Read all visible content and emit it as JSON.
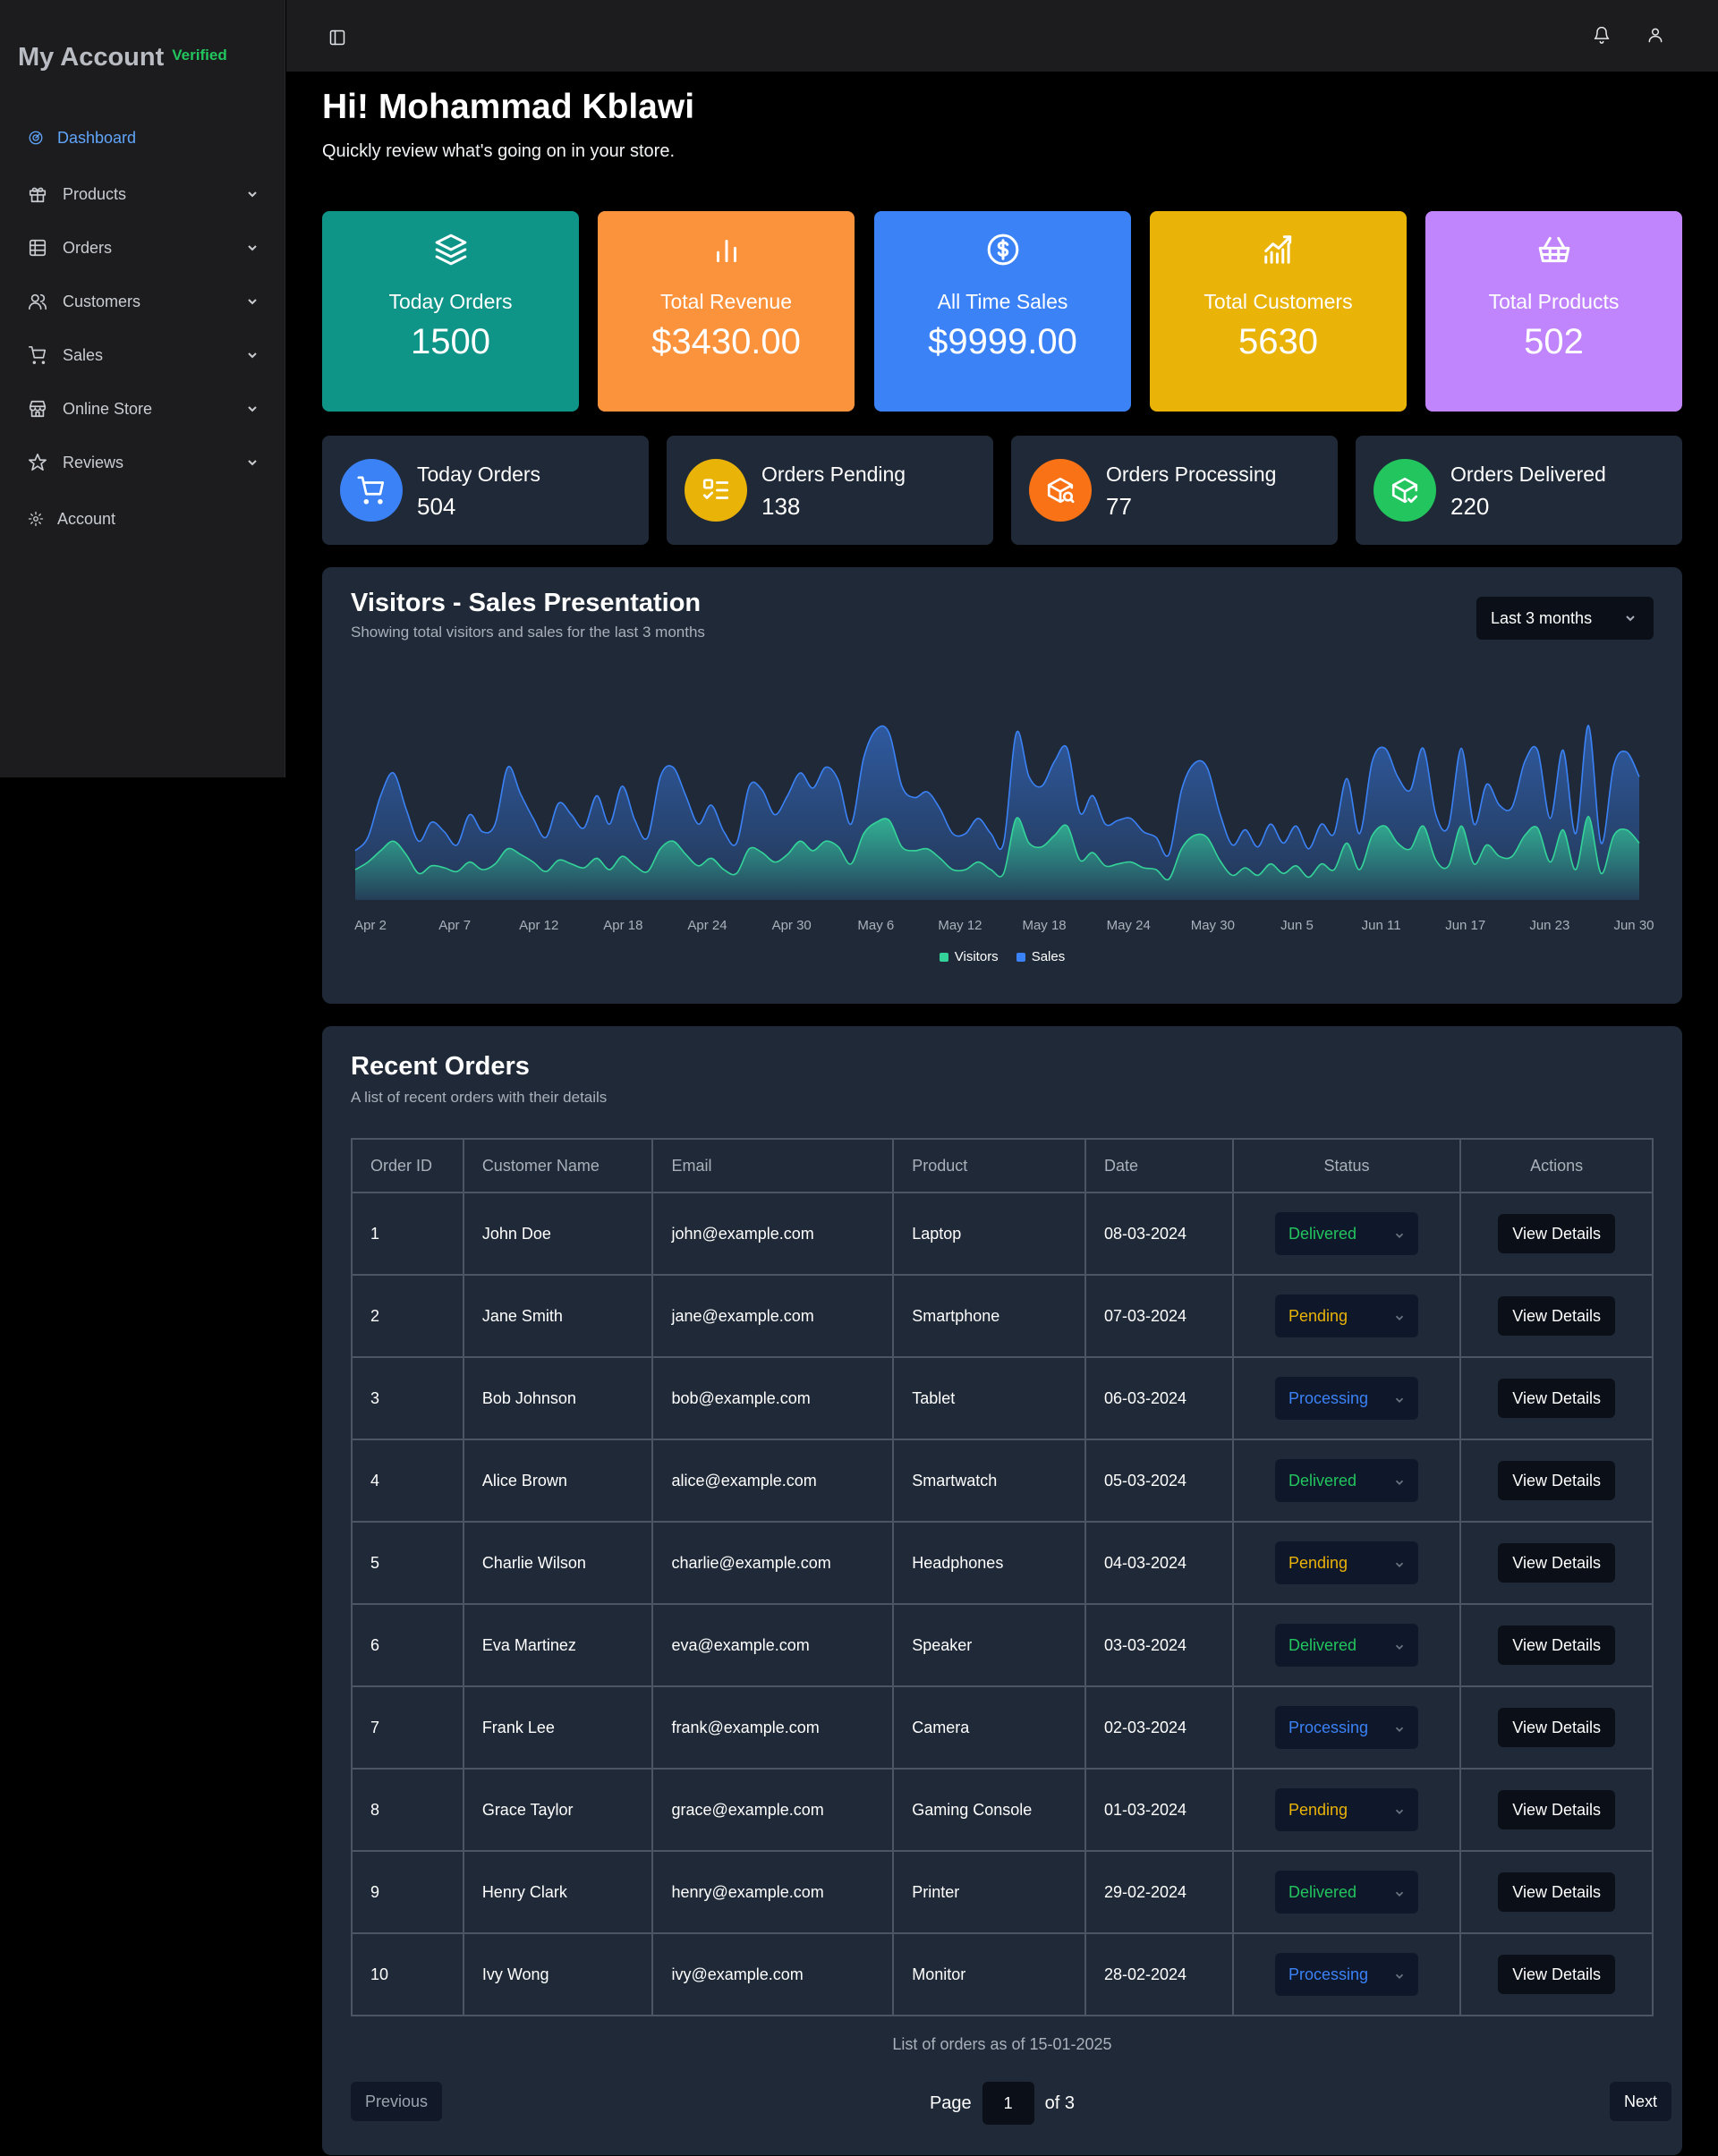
{
  "sidebar": {
    "brand_title": "My Account",
    "brand_badge": "Verified",
    "items": [
      {
        "label": "Dashboard",
        "icon": "gauge-icon"
      },
      {
        "label": "Products",
        "icon": "gift-icon"
      },
      {
        "label": "Orders",
        "icon": "grid-table-icon"
      },
      {
        "label": "Customers",
        "icon": "users-icon"
      },
      {
        "label": "Sales",
        "icon": "cart-icon"
      },
      {
        "label": "Online Store",
        "icon": "store-icon"
      },
      {
        "label": "Reviews",
        "icon": "star-icon"
      },
      {
        "label": "Account",
        "icon": "gear-icon"
      }
    ]
  },
  "topbar": {
    "icons": [
      "sidebar-toggle-icon",
      "bell-icon",
      "user-icon"
    ]
  },
  "greeting": {
    "title": "Hi! Mohammad Kblawi",
    "subtitle": "Quickly review what's going on in your store."
  },
  "stats": [
    {
      "label": "Today Orders",
      "value": "1500",
      "color": "#0f9488",
      "icon": "layers-icon"
    },
    {
      "label": "Total Revenue",
      "value": "$3430.00",
      "color": "#fb923c",
      "icon": "bar-chart-icon"
    },
    {
      "label": "All Time Sales",
      "value": "$9999.00",
      "color": "#3b82f6",
      "icon": "dollar-circle-icon"
    },
    {
      "label": "Total Customers",
      "value": "5630",
      "color": "#eab308",
      "icon": "chart-trend-icon"
    },
    {
      "label": "Total Products",
      "value": "502",
      "color": "#c084fc",
      "icon": "basket-icon"
    }
  ],
  "mini_stats": [
    {
      "label": "Today Orders",
      "value": "504",
      "color": "#3b82f6",
      "icon": "cart-icon"
    },
    {
      "label": "Orders Pending",
      "value": "138",
      "color": "#eab308",
      "icon": "list-check-icon"
    },
    {
      "label": "Orders Processing",
      "value": "77",
      "color": "#f97316",
      "icon": "package-search-icon"
    },
    {
      "label": "Orders Delivered",
      "value": "220",
      "color": "#22c55e",
      "icon": "package-check-icon"
    }
  ],
  "chart_card": {
    "title": "Visitors - Sales Presentation",
    "subtitle": "Showing total visitors and sales for the last 3 months",
    "range_selected": "Last 3 months"
  },
  "chart_data": {
    "type": "area",
    "x_labels": [
      "Apr 2",
      "Apr 7",
      "Apr 12",
      "Apr 18",
      "Apr 24",
      "Apr 30",
      "May 6",
      "May 12",
      "May 18",
      "May 24",
      "May 30",
      "Jun 5",
      "Jun 11",
      "Jun 17",
      "Jun 23",
      "Jun 30"
    ],
    "ylim": [
      0,
      100
    ],
    "series": [
      {
        "name": "Sales",
        "color": "#3b82f6",
        "values": [
          26,
          33,
          55,
          67,
          48,
          31,
          41,
          36,
          29,
          45,
          36,
          40,
          70,
          56,
          43,
          33,
          51,
          45,
          38,
          55,
          40,
          60,
          42,
          33,
          65,
          70,
          55,
          40,
          50,
          36,
          30,
          60,
          58,
          45,
          55,
          67,
          59,
          70,
          63,
          40,
          75,
          90,
          88,
          60,
          54,
          57,
          48,
          35,
          35,
          43,
          35,
          30,
          88,
          65,
          60,
          73,
          80,
          46,
          55,
          40,
          42,
          43,
          36,
          33,
          24,
          58,
          72,
          70,
          46,
          29,
          37,
          28,
          40,
          30,
          39,
          27,
          40,
          35,
          64,
          35,
          73,
          80,
          65,
          58,
          80,
          45,
          39,
          80,
          40,
          61,
          50,
          49,
          73,
          79,
          43,
          79,
          35,
          92,
          30,
          71,
          78,
          65
        ]
      },
      {
        "name": "Visitors",
        "color": "#34d399",
        "values": [
          16,
          20,
          26,
          31,
          24,
          14,
          18,
          17,
          15,
          20,
          16,
          19,
          27,
          24,
          20,
          15,
          21,
          19,
          17,
          22,
          16,
          23,
          18,
          15,
          27,
          31,
          24,
          18,
          22,
          16,
          14,
          27,
          25,
          20,
          24,
          31,
          26,
          31,
          28,
          19,
          35,
          41,
          42,
          28,
          26,
          27,
          22,
          16,
          16,
          20,
          16,
          14,
          43,
          30,
          28,
          34,
          39,
          21,
          25,
          18,
          19,
          20,
          17,
          16,
          11,
          27,
          34,
          33,
          21,
          13,
          17,
          13,
          19,
          14,
          18,
          12,
          19,
          16,
          30,
          16,
          34,
          39,
          30,
          27,
          39,
          21,
          18,
          39,
          19,
          29,
          23,
          23,
          34,
          38,
          20,
          37,
          16,
          44,
          14,
          34,
          37,
          30
        ]
      }
    ],
    "legend": [
      "Visitors",
      "Sales"
    ],
    "legend_position": "bottom-center",
    "grid": false
  },
  "orders_card": {
    "title": "Recent Orders",
    "subtitle": "A list of recent orders with their details",
    "columns": [
      "Order ID",
      "Customer Name",
      "Email",
      "Product",
      "Date",
      "Status",
      "Actions"
    ],
    "action_label": "View Details",
    "status_colors": {
      "Delivered": "#22c55e",
      "Pending": "#eab308",
      "Processing": "#3b82f6"
    },
    "rows": [
      {
        "id": "1",
        "name": "John Doe",
        "email": "john@example.com",
        "product": "Laptop",
        "date": "08-03-2024",
        "status": "Delivered"
      },
      {
        "id": "2",
        "name": "Jane Smith",
        "email": "jane@example.com",
        "product": "Smartphone",
        "date": "07-03-2024",
        "status": "Pending"
      },
      {
        "id": "3",
        "name": "Bob Johnson",
        "email": "bob@example.com",
        "product": "Tablet",
        "date": "06-03-2024",
        "status": "Processing"
      },
      {
        "id": "4",
        "name": "Alice Brown",
        "email": "alice@example.com",
        "product": "Smartwatch",
        "date": "05-03-2024",
        "status": "Delivered"
      },
      {
        "id": "5",
        "name": "Charlie Wilson",
        "email": "charlie@example.com",
        "product": "Headphones",
        "date": "04-03-2024",
        "status": "Pending"
      },
      {
        "id": "6",
        "name": "Eva Martinez",
        "email": "eva@example.com",
        "product": "Speaker",
        "date": "03-03-2024",
        "status": "Delivered"
      },
      {
        "id": "7",
        "name": "Frank Lee",
        "email": "frank@example.com",
        "product": "Camera",
        "date": "02-03-2024",
        "status": "Processing"
      },
      {
        "id": "8",
        "name": "Grace Taylor",
        "email": "grace@example.com",
        "product": "Gaming Console",
        "date": "01-03-2024",
        "status": "Pending"
      },
      {
        "id": "9",
        "name": "Henry Clark",
        "email": "henry@example.com",
        "product": "Printer",
        "date": "29-02-2024",
        "status": "Delivered"
      },
      {
        "id": "10",
        "name": "Ivy Wong",
        "email": "ivy@example.com",
        "product": "Monitor",
        "date": "28-02-2024",
        "status": "Processing"
      }
    ],
    "caption": "List of orders as of 15-01-2025",
    "pagination": {
      "previous": "Previous",
      "page_label": "Page",
      "page": "1",
      "of_label": "of 3",
      "next": "Next"
    }
  }
}
